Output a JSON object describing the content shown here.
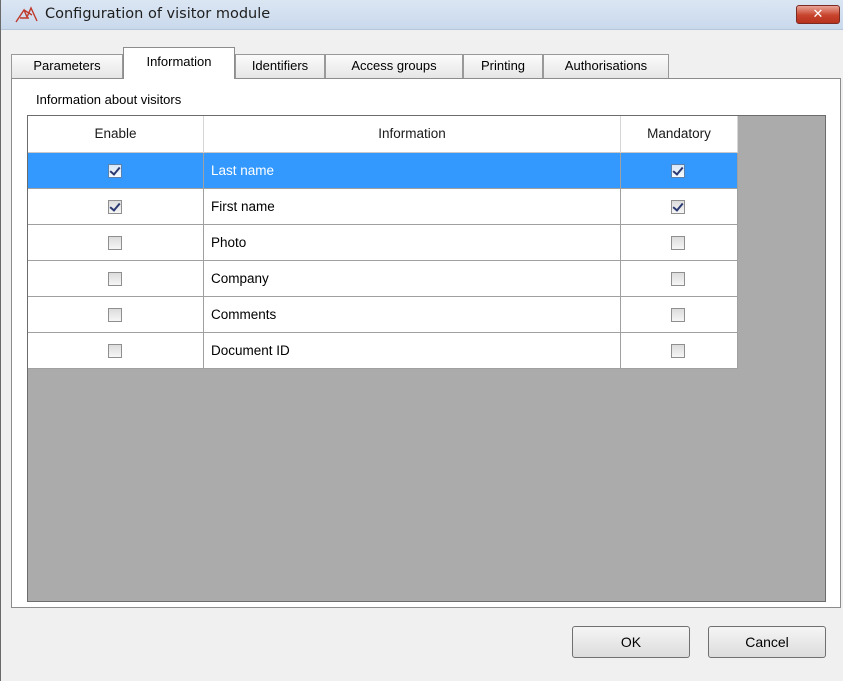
{
  "window": {
    "title": "Configuration of visitor module",
    "close_glyph": "✕"
  },
  "tabs": [
    {
      "label": "Parameters",
      "active": false
    },
    {
      "label": "Information",
      "active": true
    },
    {
      "label": "Identifiers",
      "active": false
    },
    {
      "label": "Access groups",
      "active": false
    },
    {
      "label": "Printing",
      "active": false
    },
    {
      "label": "Authorisations",
      "active": false
    }
  ],
  "group_label": "Information about visitors",
  "grid": {
    "columns": [
      "Enable",
      "Information",
      "Mandatory"
    ],
    "rows": [
      {
        "enable": true,
        "information": "Last name",
        "mandatory": true,
        "selected": true
      },
      {
        "enable": true,
        "information": "First name",
        "mandatory": true,
        "selected": false
      },
      {
        "enable": false,
        "information": "Photo",
        "mandatory": false,
        "selected": false
      },
      {
        "enable": false,
        "information": "Company",
        "mandatory": false,
        "selected": false
      },
      {
        "enable": false,
        "information": "Comments",
        "mandatory": false,
        "selected": false
      },
      {
        "enable": false,
        "information": "Document ID",
        "mandatory": false,
        "selected": false
      }
    ]
  },
  "buttons": {
    "ok": "OK",
    "cancel": "Cancel"
  },
  "colors": {
    "selection": "#3399ff",
    "grid_background": "#ababab"
  }
}
